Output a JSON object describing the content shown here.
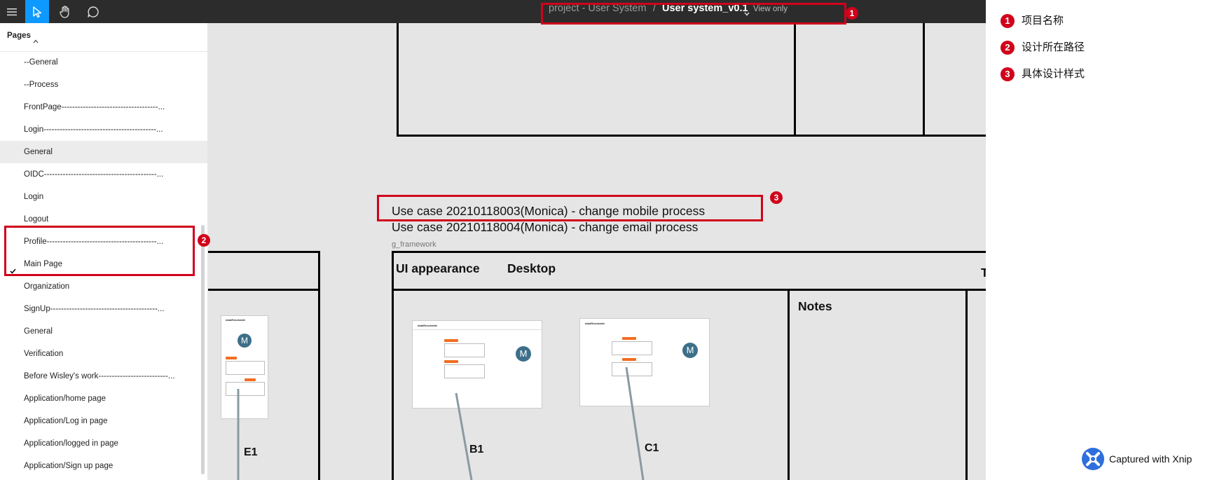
{
  "toolbar": {
    "menu_icon": "hamburger-menu-icon",
    "tools": [
      "move-cursor-icon",
      "hand-icon",
      "comment-icon"
    ],
    "active_color": "#0d99ff"
  },
  "breadcrumb": {
    "project": "project - User System",
    "separator": "/",
    "file": "User system_v0.1",
    "mode": "View only"
  },
  "sidebar": {
    "pages_label": "Pages",
    "items": [
      {
        "label": "--General"
      },
      {
        "label": "--Process"
      },
      {
        "label": "FrontPage------------------------------------..."
      },
      {
        "label": "Login------------------------------------------..."
      },
      {
        "label": "General"
      },
      {
        "label": "OIDC------------------------------------------..."
      },
      {
        "label": "Login"
      },
      {
        "label": "Logout"
      },
      {
        "label": "Profile-----------------------------------------..."
      },
      {
        "label": "Main Page"
      },
      {
        "label": "Organization"
      },
      {
        "label": "SignUp----------------------------------------..."
      },
      {
        "label": "General"
      },
      {
        "label": "Verification"
      },
      {
        "label": "Before Wisley's work--------------------------..."
      },
      {
        "label": "Application/home page"
      },
      {
        "label": "Application/Log in page"
      },
      {
        "label": "Application/logged in page"
      },
      {
        "label": "Application/Sign up page"
      }
    ]
  },
  "canvas": {
    "use_case_1": "Use case 20210118003(Monica) - change mobile process",
    "use_case_2": "Use case 20210118004(Monica) - change email process",
    "framework_label": "g_framework",
    "ui_appearance": "UI appearance",
    "desktop": "Desktop",
    "notes": "Notes",
    "cut_letter": "T",
    "frame_labels": {
      "e1": "E1",
      "b1": "B1",
      "c1": "C1"
    },
    "thumb_brand": "dataReachable",
    "thumb_avatar": "M"
  },
  "annotations": {
    "badges": [
      "1",
      "2",
      "3"
    ],
    "color": "#d0021b"
  },
  "legend": [
    {
      "num": "1",
      "text": "项目名称"
    },
    {
      "num": "2",
      "text": "设计所在路径"
    },
    {
      "num": "3",
      "text": "具体设计样式"
    }
  ],
  "watermark": {
    "text": "Captured with Xnip",
    "icon": "xnip-logo-icon"
  }
}
